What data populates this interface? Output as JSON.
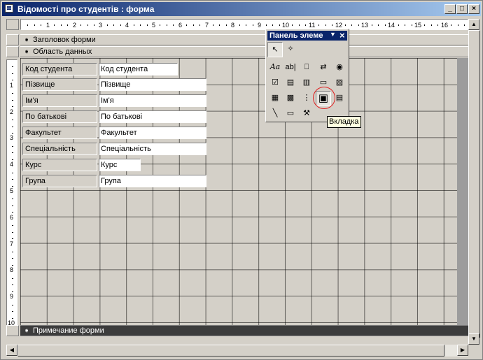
{
  "window": {
    "title": "Відомості про студентів : форма",
    "minimize_glyph": "_",
    "maximize_glyph": "□",
    "close_glyph": "×"
  },
  "ruler": {
    "horizontal": [
      "1",
      "2",
      "3",
      "4",
      "5",
      "6",
      "7",
      "8",
      "9",
      "10",
      "11",
      "12",
      "13",
      "14",
      "15",
      "16"
    ],
    "vertical": [
      "1",
      "2",
      "3",
      "4",
      "5",
      "6",
      "7",
      "8",
      "9",
      "10"
    ]
  },
  "sections": {
    "header": "Заголовок форми",
    "detail": "Область данных",
    "footer": "Примечание форми"
  },
  "fields": [
    {
      "label": "Код студента",
      "value": "Код студента"
    },
    {
      "label": "Пізвище",
      "value": "Пізвище"
    },
    {
      "label": "Ім'я",
      "value": "Ім'я"
    },
    {
      "label": "По батькові",
      "value": "По батькові"
    },
    {
      "label": "Факультет",
      "value": "Факультет"
    },
    {
      "label": "Спеціальність",
      "value": "Спеціальність"
    },
    {
      "label": "Курс",
      "value": "Курс"
    },
    {
      "label": "Група",
      "value": "Група"
    }
  ],
  "toolbox": {
    "title": "Панель элеме",
    "dropdown_glyph": "▼",
    "close_glyph": "×",
    "tools": [
      "select-objects-icon",
      "control-wizards-icon",
      "label-icon",
      "textbox-icon",
      "option-group-icon",
      "toggle-button-icon",
      "option-button-icon",
      "checkbox-icon",
      "combo-box-icon",
      "list-box-icon",
      "command-button-icon",
      "image-icon",
      "unbound-object-frame-icon",
      "bound-object-frame-icon",
      "page-break-icon",
      "tab-control-icon",
      "subform-icon",
      "line-icon",
      "rectangle-icon",
      "more-controls-icon"
    ]
  },
  "tooltip": "Вкладка",
  "accent": "#0a246a",
  "highlight_color": "#e02020"
}
